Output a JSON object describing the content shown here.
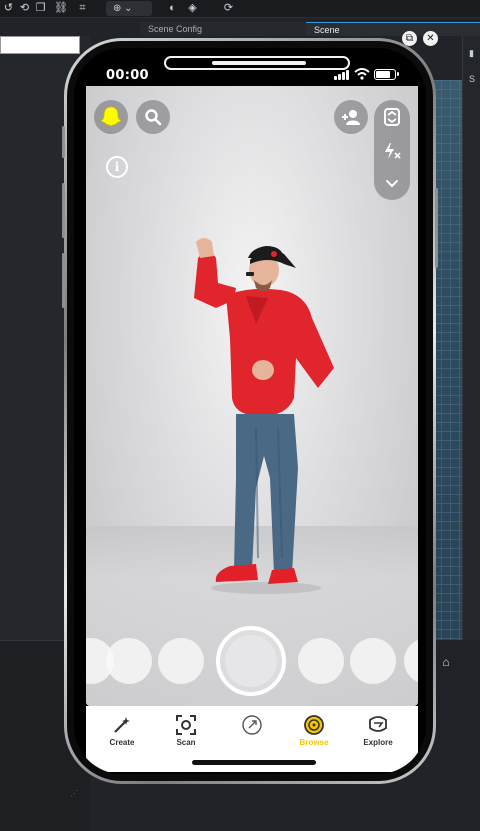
{
  "app": {
    "tabs": [
      {
        "label": "Scene Config"
      },
      {
        "label": "Scene"
      }
    ]
  },
  "preview": {
    "status_time": "00:00",
    "battery_level": 0.85
  },
  "camera": {
    "info_glyph": "i",
    "icons": {
      "profile": "ghost-icon",
      "search": "search-icon",
      "add_friend": "add-friend-icon",
      "flip": "flip-camera-icon",
      "flash": "flash-off-icon",
      "more": "chevron-down-icon"
    },
    "lens_count": 6
  },
  "nav": {
    "items": [
      {
        "label": "Create",
        "icon": "create-icon"
      },
      {
        "label": "Scan",
        "icon": "scan-icon"
      },
      {
        "label": "",
        "icon": "lens-icon"
      },
      {
        "label": "Browse",
        "icon": "browse-icon",
        "active": true
      },
      {
        "label": "Explore",
        "icon": "explore-icon"
      }
    ]
  },
  "colors": {
    "accent": "#f7c600",
    "shirt": "#e0252c",
    "jeans": "#4a6985",
    "shoes": "#e1202a"
  }
}
